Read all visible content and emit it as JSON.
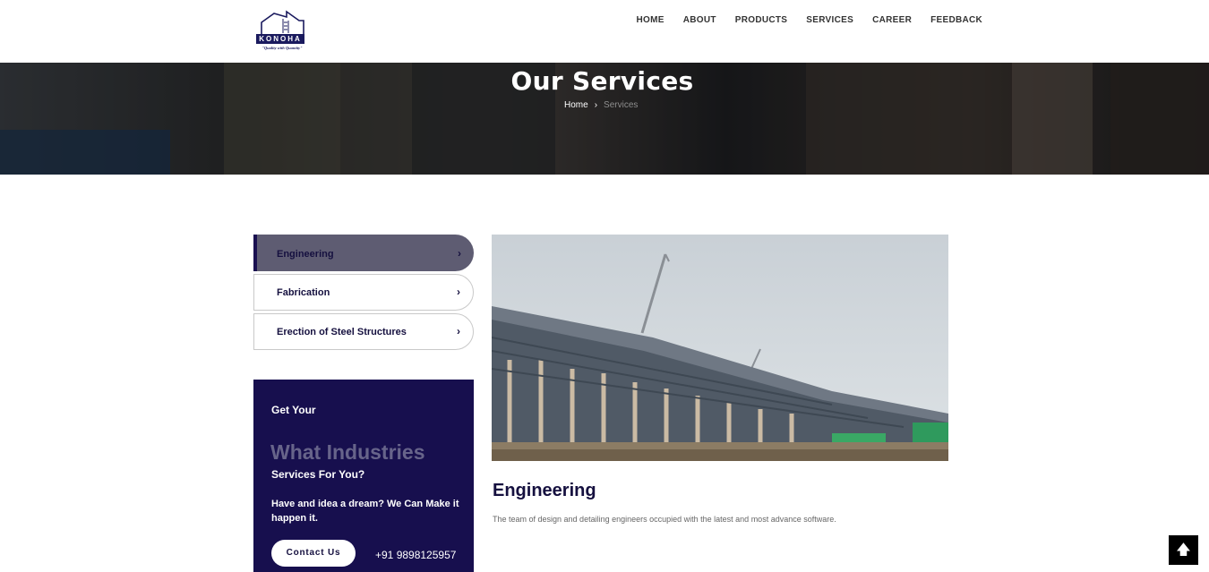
{
  "header": {
    "logo_text": "KONOHA",
    "logo_tagline": "\"Quality with Quantity\"",
    "nav": [
      "HOME",
      "ABOUT",
      "PRODUCTS",
      "SERVICES",
      "CAREER",
      "FEEDBACK"
    ]
  },
  "hero": {
    "title": "Our Services",
    "breadcrumb": {
      "home": "Home",
      "separator": "›",
      "current": "Services"
    }
  },
  "sidebar": {
    "services": [
      {
        "label": "Engineering",
        "active": true
      },
      {
        "label": "Fabrication",
        "active": false
      },
      {
        "label": "Erection of Steel Structures",
        "active": false
      }
    ],
    "chevron_icon": "chevron-right-icon",
    "promo": {
      "kicker": "Get Your",
      "headline": "What Industries",
      "subline": "Services For You?",
      "description": "Have and idea a dream? We Can Make it happen it.",
      "button_label": "Contact Us",
      "phone": "+91 9898125957"
    }
  },
  "main": {
    "title": "Engineering",
    "description": "The team of design and detailing engineers occupied with the latest and most advance software."
  },
  "scroll_top_icon": "arrow-up-icon",
  "colors": {
    "brand_navy": "#170f4e",
    "active_tab": "#5e5c72",
    "muted_heading": "#67648a"
  }
}
